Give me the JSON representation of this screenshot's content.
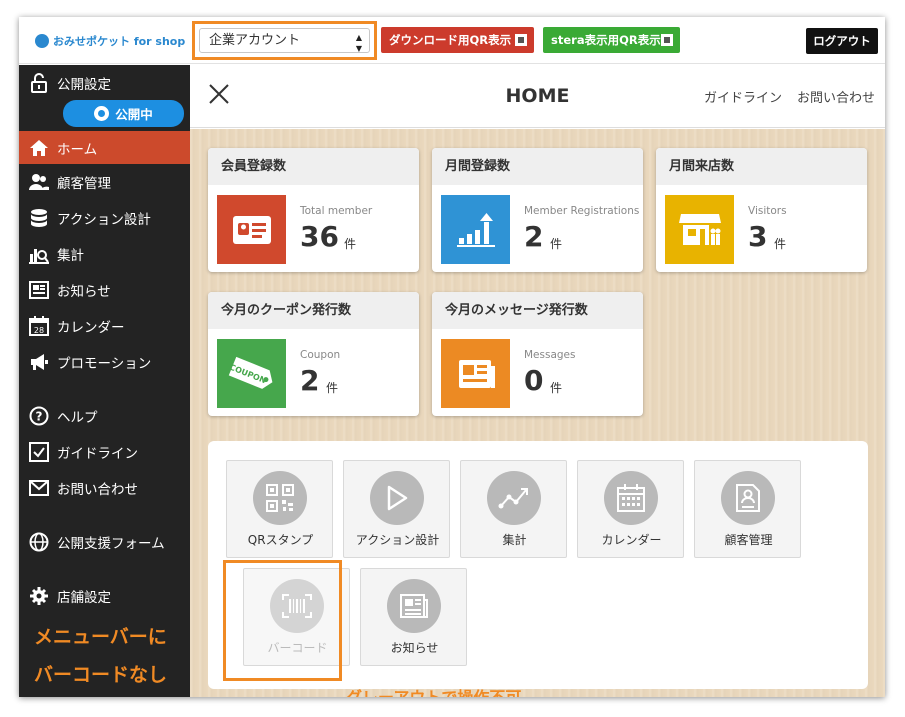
{
  "brand": {
    "logo_text": "おみせポケット for shop"
  },
  "topbar": {
    "account_select": {
      "value": "企業アカウント"
    },
    "download_qr_label": "ダウンロード用QR表示",
    "stera_qr_label": "stera表示用QR表示",
    "logout_label": "ログアウト"
  },
  "sidebar": {
    "publish_settings": "公開設定",
    "publish_status": "公開中",
    "items": [
      {
        "label": "ホーム",
        "icon": "home-icon",
        "active": true
      },
      {
        "label": "顧客管理",
        "icon": "users-icon"
      },
      {
        "label": "アクション設計",
        "icon": "database-icon"
      },
      {
        "label": "集計",
        "icon": "chart-search-icon"
      },
      {
        "label": "お知らせ",
        "icon": "newspaper-icon"
      },
      {
        "label": "カレンダー",
        "icon": "calendar-icon"
      },
      {
        "label": "プロモーション",
        "icon": "megaphone-icon"
      },
      {
        "label": "ヘルプ",
        "icon": "help-icon"
      },
      {
        "label": "ガイドライン",
        "icon": "check-box-icon"
      },
      {
        "label": "お問い合わせ",
        "icon": "mail-icon"
      },
      {
        "label": "公開支援フォーム",
        "icon": "globe-icon"
      },
      {
        "label": "店舗設定",
        "icon": "gear-icon"
      }
    ],
    "annotation_line1": "メニューバーに",
    "annotation_line2": "バーコードなし"
  },
  "header": {
    "title": "HOME",
    "guideline_link": "ガイドライン",
    "contact_link": "お問い合わせ"
  },
  "stats": [
    {
      "title": "会員登録数",
      "sub": "Total member",
      "value": "36",
      "unit": "件",
      "color": "#d0492d",
      "icon": "member-card-icon"
    },
    {
      "title": "月間登録数",
      "sub": "Member Registrations",
      "value": "2",
      "unit": "件",
      "color": "#2f93d5",
      "icon": "bar-growth-icon"
    },
    {
      "title": "月間来店数",
      "sub": "Visitors",
      "value": "3",
      "unit": "件",
      "color": "#e8b300",
      "icon": "store-visitors-icon"
    },
    {
      "title": "今月のクーポン発行数",
      "sub": "Coupon",
      "value": "2",
      "unit": "件",
      "color": "#46a74c",
      "icon": "coupon-icon",
      "icon_text": "COUPON"
    },
    {
      "title": "今月のメッセージ発行数",
      "sub": "Messages",
      "value": "0",
      "unit": "件",
      "color": "#ec8a23",
      "icon": "newspaper-icon"
    }
  ],
  "shortcuts": [
    {
      "label": "QRスタンプ",
      "icon": "qr-stamp-icon"
    },
    {
      "label": "アクション設計",
      "icon": "play-icon"
    },
    {
      "label": "集計",
      "icon": "trend-line-icon"
    },
    {
      "label": "カレンダー",
      "icon": "calendar-icon"
    },
    {
      "label": "顧客管理",
      "icon": "customer-doc-icon"
    },
    {
      "label": "バーコード",
      "icon": "barcode-icon",
      "disabled": true
    },
    {
      "label": "お知らせ",
      "icon": "newspaper-icon"
    }
  ],
  "annotations": {
    "grayout_note": "グレーアウトで操作不可"
  }
}
